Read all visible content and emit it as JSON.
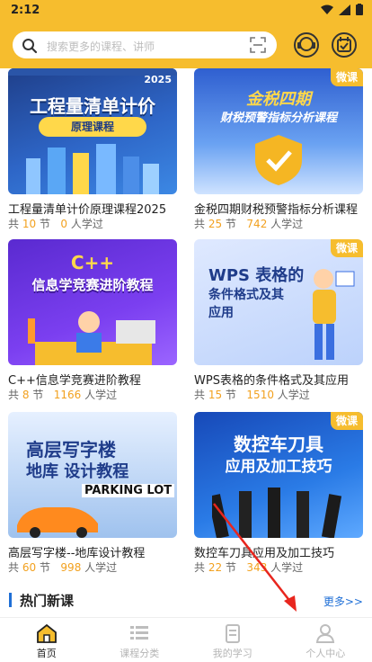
{
  "status": {
    "time": "2:12"
  },
  "search": {
    "placeholder": "搜索更多的课程、讲师"
  },
  "courses": [
    {
      "thumb_title": "工程量清单计价",
      "thumb_sub": "原理课程",
      "thumb_year": "2025",
      "title": "工程量清单计价原理课程2025",
      "lessons": "10",
      "learners": "0",
      "badge": ""
    },
    {
      "thumb_title": "金税四期",
      "thumb_sub": "财税预警指标分析课程",
      "thumb_year": "",
      "title": "金税四期财税预警指标分析课程",
      "lessons": "25",
      "learners": "742",
      "badge": "微课"
    },
    {
      "thumb_title": "C++",
      "thumb_sub": "信息学竞赛进阶教程",
      "thumb_year": "",
      "title": "C++信息学竞赛进阶教程",
      "lessons": "8",
      "learners": "1166",
      "badge": ""
    },
    {
      "thumb_title": "WPS 表格的",
      "thumb_sub": "条件格式及其应用",
      "thumb_year": "",
      "title": "WPS表格的条件格式及其应用",
      "lessons": "15",
      "learners": "1510",
      "badge": "微课"
    },
    {
      "thumb_title": "高层写字楼",
      "thumb_sub": "地库 设计教程",
      "thumb_year": "PARKING LOT",
      "title": "高层写字楼--地库设计教程",
      "lessons": "60",
      "learners": "998",
      "badge": ""
    },
    {
      "thumb_title": "数控车刀具",
      "thumb_sub": "应用及加工技巧",
      "thumb_year": "",
      "title": "数控车刀具应用及加工技巧",
      "lessons": "22",
      "learners": "343",
      "badge": "微课"
    }
  ],
  "labels": {
    "prefix": "共",
    "lesson_unit": "节",
    "learner_unit": "人学过"
  },
  "section": {
    "title": "热门新课",
    "more": "更多>>"
  },
  "tabs": [
    {
      "label": "首页",
      "icon": "home-icon",
      "active": true
    },
    {
      "label": "课程分类",
      "icon": "category-icon",
      "active": false
    },
    {
      "label": "我的学习",
      "icon": "study-icon",
      "active": false
    },
    {
      "label": "个人中心",
      "icon": "profile-icon",
      "active": false
    }
  ],
  "colors": {
    "accent": "#f6bd2e",
    "link": "#1f6fd6",
    "count": "#f2a11f"
  }
}
